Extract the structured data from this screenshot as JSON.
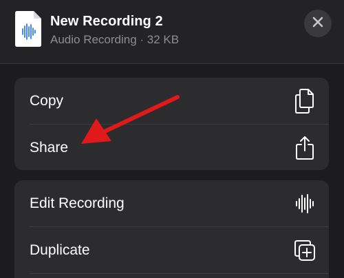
{
  "header": {
    "title": "New Recording 2",
    "subtitle": "Audio Recording · 32 KB",
    "file_icon": "audio-file-icon",
    "close_icon": "close-icon"
  },
  "menu_groups": [
    {
      "items": [
        {
          "label": "Copy",
          "icon": "copy-icon"
        },
        {
          "label": "Share",
          "icon": "share-icon"
        }
      ]
    },
    {
      "items": [
        {
          "label": "Edit Recording",
          "icon": "waveform-icon"
        },
        {
          "label": "Duplicate",
          "icon": "duplicate-icon"
        }
      ]
    }
  ],
  "colors": {
    "background": "#1c1c1e",
    "group_background": "#2c2c2e",
    "accent_waveform": "#3478f6",
    "annotation_arrow": "#e0191b"
  }
}
